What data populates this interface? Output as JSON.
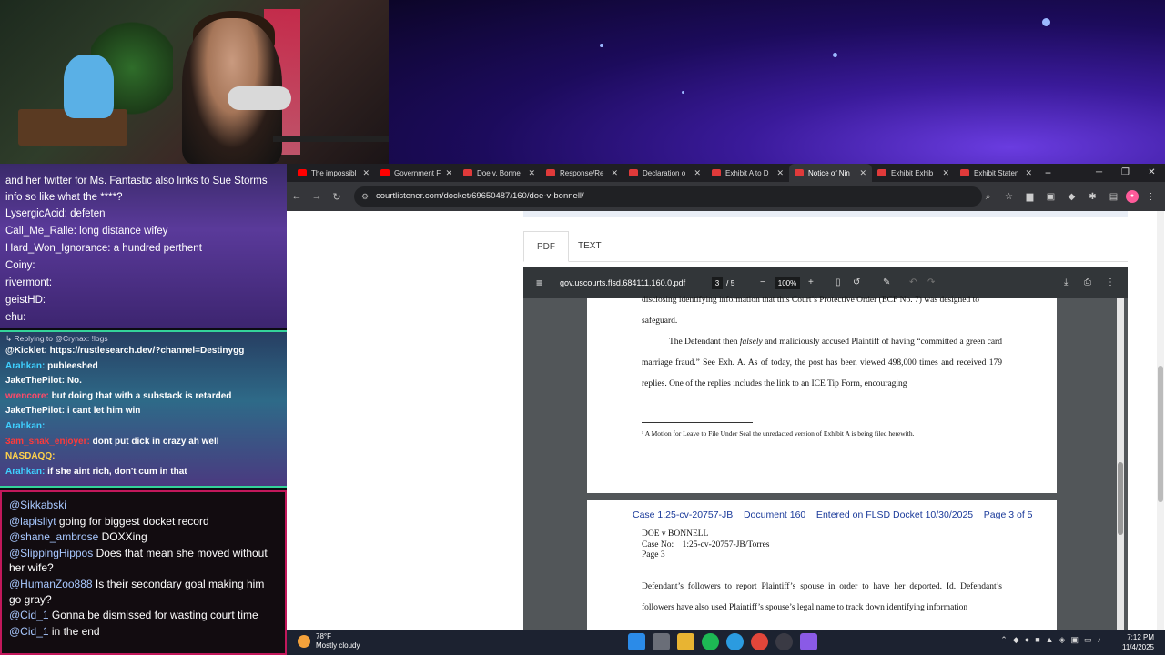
{
  "chat_top": {
    "lines": [
      {
        "text": "and her twitter for Ms. Fantastic also links to Sue Storms info so like what the ****?",
        "wrap": true
      },
      {
        "text": "LysergicAcid: defeten"
      },
      {
        "text": "Call_Me_Ralle: long distance wifey"
      },
      {
        "text": "Hard_Won_Ignorance: a hundred perthent"
      },
      {
        "text": "Coiny:"
      },
      {
        "text": "rivermont:"
      },
      {
        "text": "geistHD:"
      },
      {
        "text": "ehu:"
      }
    ]
  },
  "chat_mid": {
    "reply_note": "↳ Replying to @Crynax: !logs",
    "lines": [
      {
        "name": "@Kicklet:",
        "color": "#ffffff",
        "msg": "https://rustlesearch.dev/?channel=Destinygg"
      },
      {
        "name": "Arahkan:",
        "color": "#3fd0ff",
        "msg": "publeeshed"
      },
      {
        "name": "JakeThePilot:",
        "color": "#ffffff",
        "msg": "No."
      },
      {
        "name": "wrencore:",
        "color": "#ff4a6a",
        "msg": "but doing that with a substack is retarded"
      },
      {
        "name": "JakeThePilot:",
        "color": "#ffffff",
        "msg": "i cant let him win"
      },
      {
        "name": "Arahkan:",
        "color": "#3fd0ff",
        "msg": ""
      },
      {
        "name": "3am_snak_enjoyer:",
        "color": "#ff3a3a",
        "msg": "dont put dick in crazy ah well"
      },
      {
        "name": "NASDAQQ:",
        "color": "#ffd24a",
        "msg": ""
      },
      {
        "name": "Arahkan:",
        "color": "#3fd0ff",
        "msg": "if she aint rich, don't cum in that"
      }
    ]
  },
  "chat_bot": {
    "lines": [
      {
        "user": "@Sikkabski",
        "msg": ""
      },
      {
        "user": "@lapisliyt",
        "msg": "going for biggest docket record"
      },
      {
        "user": "@shane_ambrose",
        "msg": "DOXXing"
      },
      {
        "user": "@SlippingHippos",
        "msg": "Does that mean she moved without her wife?"
      },
      {
        "user": "@HumanZoo888",
        "msg": "Is their secondary goal making him go gray?"
      },
      {
        "user": "@Cid_1",
        "msg": "Gonna be dismissed for wasting court time"
      },
      {
        "user": "@Cid_1",
        "msg": "in the end"
      }
    ]
  },
  "browser": {
    "tabs": [
      {
        "label": "The impossibl",
        "fav": "#ff0000"
      },
      {
        "label": "Government F",
        "fav": "#ff0000"
      },
      {
        "label": "Doe v. Bonne",
        "fav": "#e03a3a"
      },
      {
        "label": "Response/Re",
        "fav": "#e03a3a"
      },
      {
        "label": "Declaration o",
        "fav": "#e03a3a"
      },
      {
        "label": "Exhibit A to D",
        "fav": "#e03a3a"
      },
      {
        "label": "Notice of Nin",
        "fav": "#e03a3a"
      },
      {
        "label": "Exhibit Exhib",
        "fav": "#e03a3a"
      },
      {
        "label": "Exhibit Staten",
        "fav": "#e03a3a"
      }
    ],
    "new_tab": "+",
    "url": "courtlistener.com/docket/69650487/160/doe-v-bonnell/",
    "tabs_pdf": {
      "pdf": "PDF",
      "text": "TEXT"
    },
    "pdf_toolbar": {
      "filename": "gov.uscourts.flsd.684111.160.0.pdf",
      "page": "3",
      "page_of": "/  5",
      "zoom": "100%"
    }
  },
  "doc": {
    "p1a": "disclosing identifying information that this Court’s Protective Order (ECF No. 7) was designed to",
    "p1b": "safeguard.",
    "p2": "The Defendant then falsely and maliciously accused Plaintiff of having “committed a green card marriage fraud.” See Exh. A. As of today, the post has been viewed 498,000 times and received 179 replies. One of the replies includes the link to an ICE Tip Form, encouraging",
    "footnote": "¹ A Motion for Leave to File Under Seal the unredacted version of Exhibit A is being filed herewith.",
    "header": "Case 1:25-cv-20757-JB    Document 160    Entered on FLSD Docket 10/30/2025    Page 3 of 5",
    "caption1": "DOE v BONNELL",
    "caption2": "Case No:    1:25-cv-20757-JB/Torres",
    "caption3": "Page 3",
    "p3": "Defendant’s followers to report Plaintiff’s spouse in order to have her deported. Id. Defendant’s followers have also used Plaintiff’s spouse’s legal name to track down identifying information"
  },
  "taskbar": {
    "temp": "78°F",
    "weather": "Mostly cloudy",
    "time": "7:12 PM",
    "date": "11/4/2025"
  }
}
